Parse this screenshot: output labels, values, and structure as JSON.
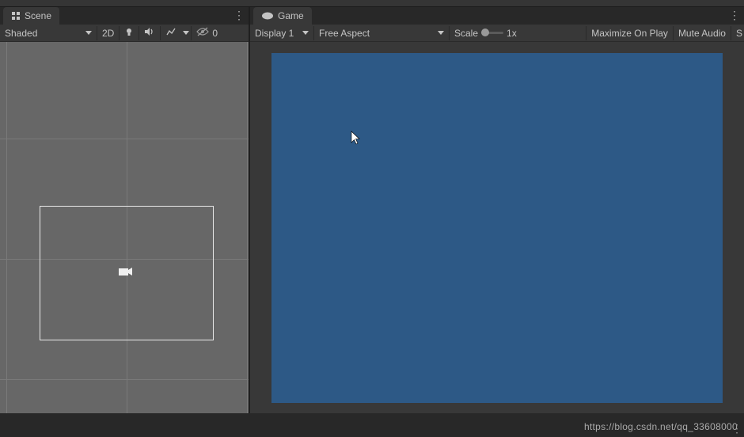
{
  "scene": {
    "tab_label": "Scene",
    "shading_mode": "Shaded",
    "mode_2d": "2D",
    "gizmo_count": "0"
  },
  "game": {
    "tab_label": "Game",
    "display": "Display 1",
    "aspect": "Free Aspect",
    "scale_label": "Scale",
    "scale_value": "1x",
    "maximize": "Maximize On Play",
    "mute": "Mute Audio",
    "stats_partial": "S",
    "viewport_color": "#2d5986"
  },
  "icons": {
    "scene": "scene-icon",
    "game": "game-icon",
    "light": "light-icon",
    "audio": "audio-icon",
    "fx": "fx-icon",
    "gizmo_visibility": "eye-off-icon"
  },
  "watermark": "https://blog.csdn.net/qq_33608000"
}
